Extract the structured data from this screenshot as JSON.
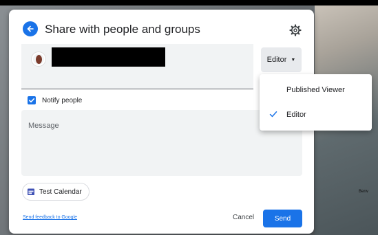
{
  "dialog": {
    "title": "Share with people and groups",
    "role_selected": "Editor",
    "notify_label": "Notify people",
    "notify_checked": true,
    "message_placeholder": "Message",
    "calendar_chip": "Test Calendar",
    "feedback_link": "Send feedback to Google",
    "cancel_label": "Cancel",
    "send_label": "Send"
  },
  "role_menu": {
    "items": [
      {
        "label": "Published Viewer",
        "selected": false
      },
      {
        "label": "Editor",
        "selected": true
      }
    ]
  },
  "background": {
    "map_label": "Berw"
  },
  "icons": {
    "back": "arrow-left-icon",
    "settings": "gear-icon",
    "dropdown": "caret-down-icon",
    "checkbox": "checkbox-checked-icon",
    "calendar": "calendar-icon",
    "menu_check": "check-icon"
  },
  "colors": {
    "accent": "#1a73e8",
    "field_bg": "#f1f3f4",
    "text": "#202124"
  }
}
